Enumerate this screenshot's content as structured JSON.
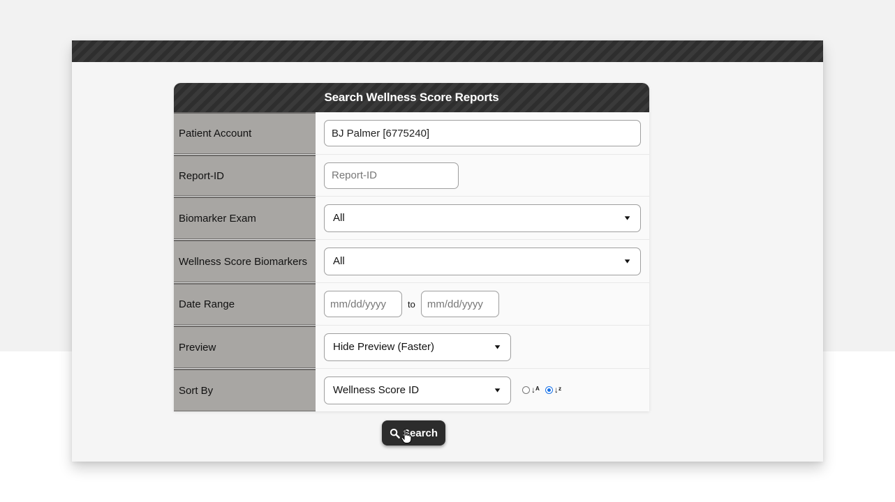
{
  "form": {
    "title": "Search Wellness Score Reports",
    "patient_account": {
      "label": "Patient Account",
      "value": "BJ Palmer [6775240]"
    },
    "report_id": {
      "label": "Report-ID",
      "placeholder": "Report-ID"
    },
    "biomarker_exam": {
      "label": "Biomarker Exam",
      "selected": "All"
    },
    "wellness_biomarkers": {
      "label": "Wellness Score Biomarkers",
      "selected": "All"
    },
    "date_range": {
      "label": "Date Range",
      "from_placeholder": "mm/dd/yyyy",
      "separator": "to",
      "to_placeholder": "mm/dd/yyyy"
    },
    "preview": {
      "label": "Preview",
      "selected": "Hide Preview (Faster)"
    },
    "sort_by": {
      "label": "Sort By",
      "selected": "Wellness Score ID",
      "ascending_icon": "sort-alpha-asc-icon",
      "descending_icon": "sort-alpha-desc-icon",
      "descending_checked": true
    }
  },
  "search_button": {
    "label": "Search",
    "icon": "search-icon"
  },
  "colors": {
    "header_bg": "#2e2e2e",
    "label_bg": "#a8a6a3",
    "radio_accent": "#1a73e8"
  }
}
